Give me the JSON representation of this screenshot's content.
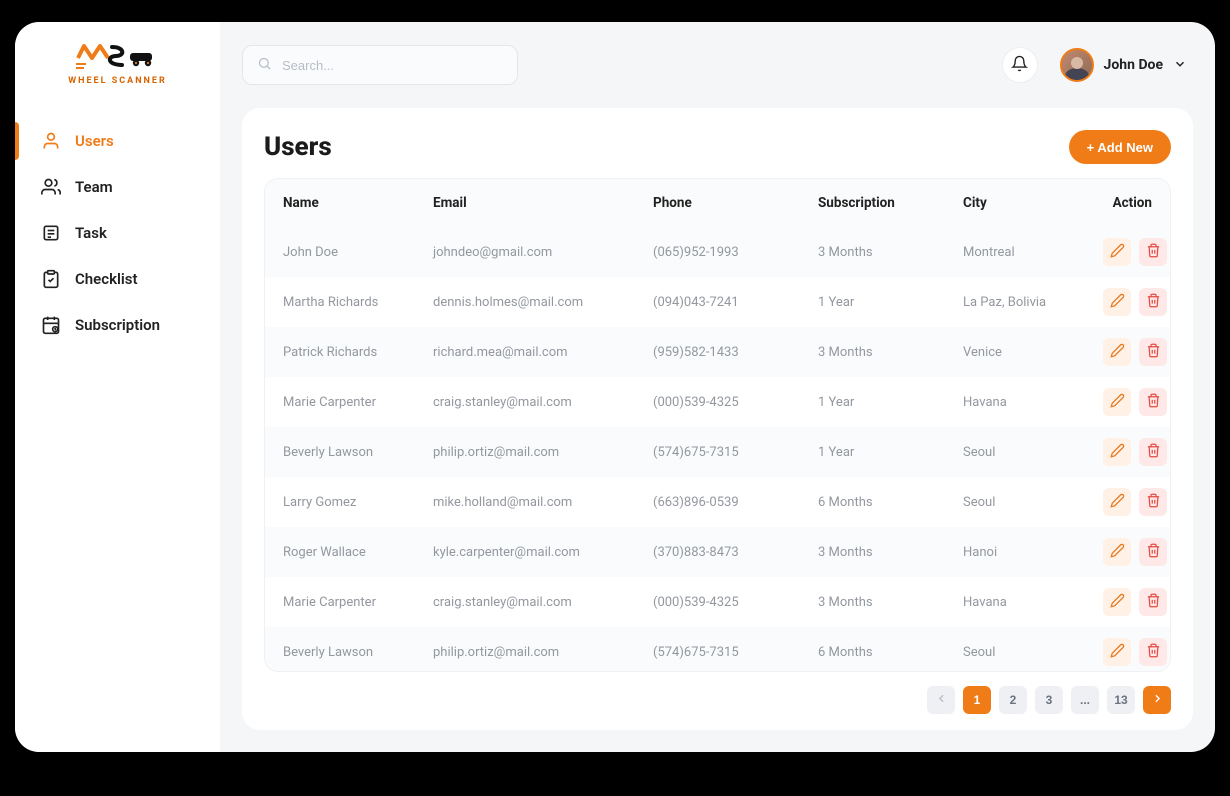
{
  "brand": {
    "name": "WHEEL SCANNER"
  },
  "search": {
    "placeholder": "Search..."
  },
  "user": {
    "name": "John Doe"
  },
  "sidebar": {
    "items": [
      {
        "label": "Users",
        "icon": "user-icon",
        "active": true
      },
      {
        "label": "Team",
        "icon": "team-icon",
        "active": false
      },
      {
        "label": "Task",
        "icon": "task-icon",
        "active": false
      },
      {
        "label": "Checklist",
        "icon": "checklist-icon",
        "active": false
      },
      {
        "label": "Subscription",
        "icon": "subscription-icon",
        "active": false
      }
    ]
  },
  "page": {
    "title": "Users",
    "add_label": "+ Add New"
  },
  "table": {
    "columns": [
      "Name",
      "Email",
      "Phone",
      "Subscription",
      "City",
      "Action"
    ],
    "rows": [
      {
        "name": "John Doe",
        "email": "johndeo@gmail.com",
        "phone": "(065)952-1993",
        "subscription": "3 Months",
        "city": "Montreal"
      },
      {
        "name": "Martha Richards",
        "email": "dennis.holmes@mail.com",
        "phone": "(094)043-7241",
        "subscription": "1 Year",
        "city": "La Paz, Bolivia"
      },
      {
        "name": "Patrick Richards",
        "email": "richard.mea@mail.com",
        "phone": "(959)582-1433",
        "subscription": "3 Months",
        "city": "Venice"
      },
      {
        "name": "Marie Carpenter",
        "email": "craig.stanley@mail.com",
        "phone": "(000)539-4325",
        "subscription": "1 Year",
        "city": "Havana"
      },
      {
        "name": "Beverly Lawson",
        "email": "philip.ortiz@mail.com",
        "phone": "(574)675-7315",
        "subscription": "1 Year",
        "city": "Seoul"
      },
      {
        "name": "Larry Gomez",
        "email": "mike.holland@mail.com",
        "phone": "(663)896-0539",
        "subscription": "6 Months",
        "city": "Seoul"
      },
      {
        "name": "Roger Wallace",
        "email": "kyle.carpenter@mail.com",
        "phone": "(370)883-8473",
        "subscription": "3 Months",
        "city": "Hanoi"
      },
      {
        "name": "Marie Carpenter",
        "email": "craig.stanley@mail.com",
        "phone": "(000)539-4325",
        "subscription": "3 Months",
        "city": "Havana"
      },
      {
        "name": "Beverly Lawson",
        "email": "philip.ortiz@mail.com",
        "phone": "(574)675-7315",
        "subscription": "6 Months",
        "city": "Seoul"
      }
    ]
  },
  "pagination": {
    "pages": [
      "1",
      "2",
      "3",
      "...",
      "13"
    ],
    "active": "1"
  },
  "colors": {
    "accent": "#f07c18"
  }
}
